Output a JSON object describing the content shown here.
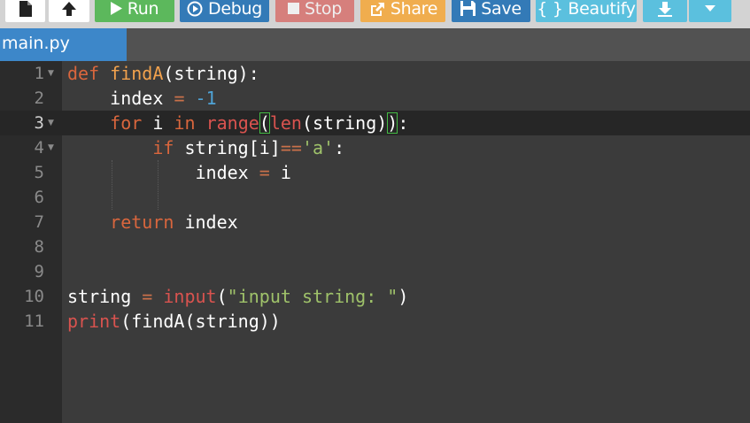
{
  "toolbar": {
    "run_label": "Run",
    "debug_label": "Debug",
    "stop_label": "Stop",
    "share_label": "Share",
    "save_label": "Save",
    "beautify_label": "{ } Beautify"
  },
  "tabs": [
    {
      "label": "main.py",
      "active": true
    }
  ],
  "editor": {
    "active_line": 3,
    "lines": [
      {
        "num": "1"
      },
      {
        "num": "2"
      },
      {
        "num": "3"
      },
      {
        "num": "4"
      },
      {
        "num": "5"
      },
      {
        "num": "6"
      },
      {
        "num": "7"
      },
      {
        "num": "8"
      },
      {
        "num": "9"
      },
      {
        "num": "10"
      },
      {
        "num": "11"
      }
    ],
    "tokens": {
      "l1": [
        "def",
        "findA",
        "(string):"
      ],
      "l2": [
        "index",
        "=",
        "-1"
      ],
      "l3": [
        "for",
        "i",
        "in",
        "range",
        "(",
        "len",
        "(string)",
        ")",
        ":"
      ],
      "l4": [
        "if",
        "string[i]",
        "==",
        "'a'",
        ":"
      ],
      "l5": [
        "index",
        "=",
        "i"
      ],
      "l7": [
        "return",
        "index"
      ],
      "l10": [
        "string",
        "=",
        "input",
        "(",
        "\"input string: \"",
        ")"
      ],
      "l11": [
        "print",
        "(findA(string))"
      ]
    }
  },
  "colors": {
    "run": "#5cb85c",
    "debug": "#337ab7",
    "stop": "#d9534f",
    "share": "#f0ad4e",
    "save": "#337ab7",
    "beautify": "#5bc0de",
    "tab_active": "#3d87c9",
    "editor_bg": "#3b3b3b",
    "keyword": "#d9663d",
    "function_name": "#f2a24d",
    "string": "#9fc26a",
    "number": "#4fa3d6"
  },
  "icons": {
    "file": "new-file-icon",
    "upload": "upload-icon",
    "run": "play-icon",
    "debug": "debug-play-circle-icon",
    "stop": "stop-square-icon",
    "share": "share-icon",
    "save": "floppy-disk-icon",
    "download": "download-icon",
    "download_menu": "caret-down-icon"
  }
}
